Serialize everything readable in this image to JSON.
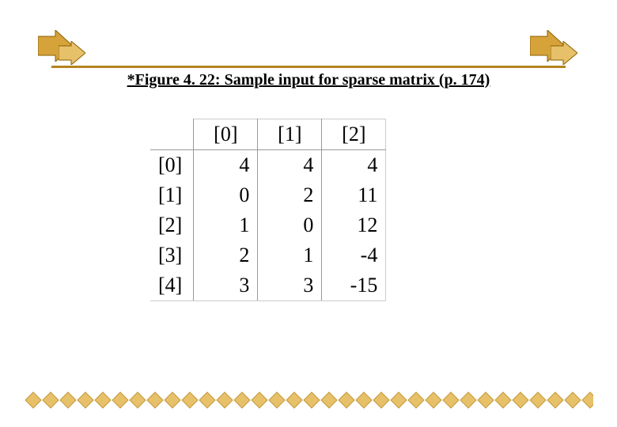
{
  "title": "*Figure 4. 22: Sample input for sparse matrix (p. 174)",
  "col_headers": [
    "[0]",
    "[1]",
    "[2]"
  ],
  "row_headers": [
    "[0]",
    "[1]",
    "[2]",
    "[3]",
    "[4]"
  ],
  "chart_data": {
    "type": "table",
    "title": "*Figure 4. 22: Sample input for sparse matrix (p. 174)",
    "columns": [
      "[0]",
      "[1]",
      "[2]"
    ],
    "rows": [
      "[0]",
      "[1]",
      "[2]",
      "[3]",
      "[4]"
    ],
    "values": [
      [
        4,
        4,
        4
      ],
      [
        0,
        2,
        11
      ],
      [
        1,
        0,
        12
      ],
      [
        2,
        1,
        -4
      ],
      [
        3,
        3,
        -15
      ]
    ]
  },
  "decor": {
    "arrow_fill": "#d6a23a",
    "arrow_stroke": "#8a6000",
    "diamond_fill": "#e7c06a",
    "diamond_stroke": "#c59a3a"
  }
}
